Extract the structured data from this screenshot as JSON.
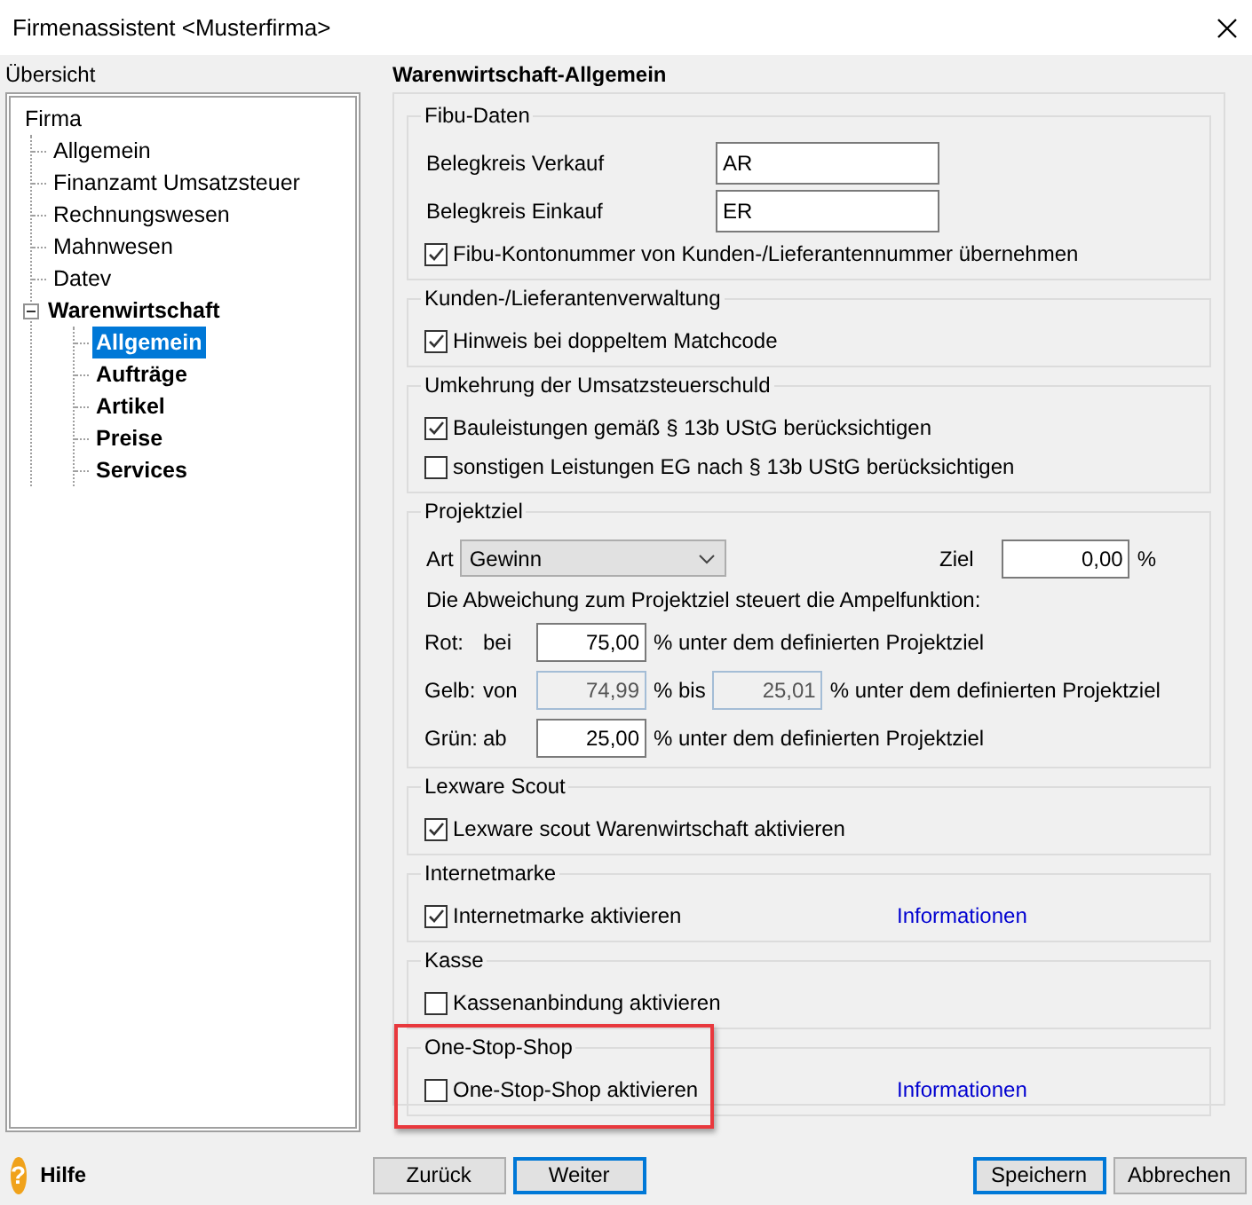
{
  "window": {
    "title": "Firmenassistent <Musterfirma>"
  },
  "sidebar": {
    "heading": "Übersicht",
    "tree": [
      {
        "label": "Firma",
        "bold": false,
        "selected": false,
        "children": [
          {
            "label": "Allgemein",
            "bold": false,
            "selected": false
          },
          {
            "label": "Finanzamt Umsatzsteuer",
            "bold": false,
            "selected": false
          },
          {
            "label": "Rechnungswesen",
            "bold": false,
            "selected": false
          },
          {
            "label": "Mahnwesen",
            "bold": false,
            "selected": false
          },
          {
            "label": "Datev",
            "bold": false,
            "selected": false
          },
          {
            "label": "Warenwirtschaft",
            "bold": true,
            "selected": false,
            "expanded": true,
            "children": [
              {
                "label": "Allgemein",
                "bold": true,
                "selected": true
              },
              {
                "label": "Aufträge",
                "bold": true,
                "selected": false
              },
              {
                "label": "Artikel",
                "bold": true,
                "selected": false
              },
              {
                "label": "Preise",
                "bold": true,
                "selected": false
              },
              {
                "label": "Services",
                "bold": true,
                "selected": false
              }
            ]
          }
        ]
      }
    ]
  },
  "main": {
    "heading": "Warenwirtschaft-Allgemein",
    "groups": [
      {
        "title": "Fibu-Daten",
        "highlighted": false,
        "rows": [
          {
            "kind": "field",
            "label": "Belegkreis Verkauf",
            "value": "AR"
          },
          {
            "kind": "field",
            "label": "Belegkreis Einkauf",
            "value": "ER"
          },
          {
            "kind": "checkbox",
            "label": "Fibu-Kontonummer von Kunden-/Lieferantennummer übernehmen",
            "checked": true
          }
        ]
      },
      {
        "title": "Kunden-/Lieferantenverwaltung",
        "highlighted": false,
        "rows": [
          {
            "kind": "checkbox",
            "label": "Hinweis bei doppeltem Matchcode",
            "checked": true
          }
        ]
      },
      {
        "title": "Umkehrung der Umsatzsteuerschuld",
        "highlighted": false,
        "rows": [
          {
            "kind": "checkbox",
            "label": "Bauleistungen gemäß § 13b UStG berücksichtigen",
            "checked": true
          },
          {
            "kind": "checkbox",
            "label": "sonstigen Leistungen EG nach § 13b UStG berücksichtigen",
            "checked": false
          }
        ]
      },
      {
        "title": "Projektziel",
        "highlighted": false,
        "rows": [
          {
            "kind": "target",
            "label": "Art",
            "select": "Gewinn",
            "target_label": "Ziel",
            "target_value": "0,00",
            "unit": "%"
          },
          {
            "kind": "note",
            "text": "Die Abweichung zum Projektziel steuert die Ampelfunktion:"
          },
          {
            "kind": "threshold",
            "label": "Rot:",
            "prep": "bei",
            "parts": [
              {
                "kind": "input",
                "value": "75,00",
                "disabled": false
              },
              {
                "kind": "text",
                "text": "% unter dem definierten Projektziel"
              }
            ]
          },
          {
            "kind": "threshold",
            "label": "Gelb:",
            "prep": "von",
            "parts": [
              {
                "kind": "input",
                "value": "74,99",
                "disabled": true
              },
              {
                "kind": "text",
                "text": "% bis"
              },
              {
                "kind": "input",
                "value": "25,01",
                "disabled": true
              },
              {
                "kind": "text",
                "text": "% unter dem definierten Projektziel"
              }
            ]
          },
          {
            "kind": "threshold",
            "label": "Grün:",
            "prep": "ab",
            "parts": [
              {
                "kind": "input",
                "value": "25,00",
                "disabled": false
              },
              {
                "kind": "text",
                "text": "% unter dem definierten Projektziel"
              }
            ]
          }
        ]
      },
      {
        "title": "Lexware Scout",
        "highlighted": false,
        "rows": [
          {
            "kind": "checkbox",
            "label": "Lexware scout Warenwirtschaft aktivieren",
            "checked": true
          }
        ]
      },
      {
        "title": "Internetmarke",
        "highlighted": false,
        "rows": [
          {
            "kind": "checkbox",
            "label": "Internetmarke aktivieren",
            "checked": true,
            "link": "Informationen"
          }
        ]
      },
      {
        "title": "Kasse",
        "highlighted": false,
        "rows": [
          {
            "kind": "checkbox",
            "label": "Kassenanbindung aktivieren",
            "checked": false
          }
        ]
      },
      {
        "title": "One-Stop-Shop",
        "highlighted": true,
        "rows": [
          {
            "kind": "checkbox",
            "label": "One-Stop-Shop aktivieren",
            "checked": false,
            "link": "Informationen"
          }
        ]
      }
    ]
  },
  "footer": {
    "help": {
      "icon": "?",
      "label": "Hilfe"
    },
    "buttons": [
      {
        "label": "Zurück",
        "default": false
      },
      {
        "label": "Weiter",
        "default": true
      },
      {
        "label": "Speichern",
        "default": true
      },
      {
        "label": "Abbrechen",
        "default": false
      }
    ]
  }
}
